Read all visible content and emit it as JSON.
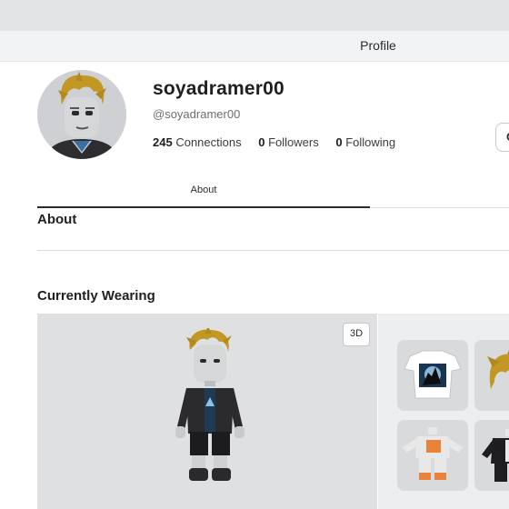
{
  "header": {
    "title": "Profile"
  },
  "profile": {
    "display_name": "soyadramer00",
    "username": "@soyadramer00",
    "stats": [
      {
        "count": "245",
        "label": "Connections"
      },
      {
        "count": "0",
        "label": "Followers"
      },
      {
        "count": "0",
        "label": "Following"
      }
    ],
    "side_button_label": "C"
  },
  "tabs": {
    "about": "About"
  },
  "sections": {
    "about_heading": "About",
    "wearing_heading": "Currently Wearing"
  },
  "viewer": {
    "toggle_label": "3D"
  },
  "worn_items": [
    {
      "icon": "wolf-shirt-icon"
    },
    {
      "icon": "hair-icon"
    },
    {
      "icon": "orange-outfit-icon"
    },
    {
      "icon": "black-outfit-icon"
    }
  ]
}
